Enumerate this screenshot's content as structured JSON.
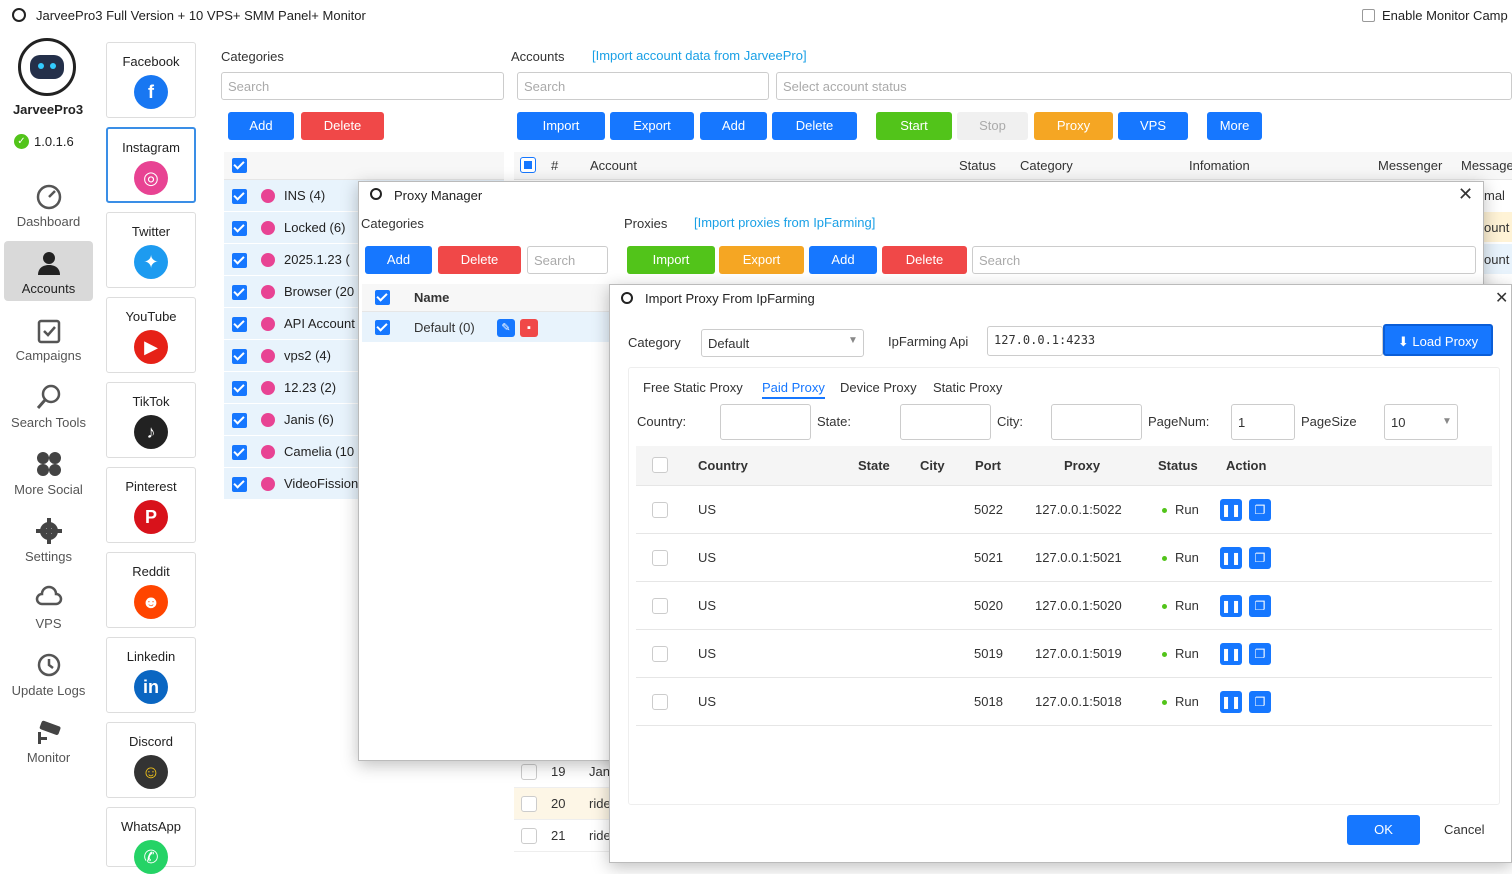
{
  "window": {
    "title": "JarveePro3 Full Version + 10 VPS+ SMM Panel+ Monitor",
    "enable_monitor": "Enable Monitor Camp"
  },
  "brand": {
    "name": "JarveePro3",
    "version": "1.0.1.6"
  },
  "nav": [
    "Dashboard",
    "Accounts",
    "Campaigns",
    "Search Tools",
    "More Social",
    "Settings",
    "VPS",
    "Update Logs",
    "Monitor"
  ],
  "social": [
    "Facebook",
    "Instagram",
    "Twitter",
    "YouTube",
    "TikTok",
    "Pinterest",
    "Reddit",
    "Linkedin",
    "Discord",
    "WhatsApp"
  ],
  "categories_panel": {
    "title": "Categories",
    "search": "Search",
    "add": "Add",
    "delete": "Delete",
    "rows": [
      "INS (4)",
      "Locked (6)",
      "2025.1.23 (",
      "Browser (20",
      "API Account",
      "vps2 (4)",
      "12.23 (2)",
      "Janis (6)",
      "Camelia (10",
      "VideoFission"
    ]
  },
  "accounts_panel": {
    "title": "Accounts",
    "import_link": "[Import account data from JarveePro]",
    "search": "Search",
    "status_placeholder": "Select account status",
    "buttons": {
      "import": "Import",
      "export": "Export",
      "add": "Add",
      "delete": "Delete",
      "start": "Start",
      "stop": "Stop",
      "proxy": "Proxy",
      "vps": "VPS",
      "more": "More"
    },
    "columns": {
      "num": "#",
      "account": "Account",
      "status": "Status",
      "category": "Category",
      "information": "Infomation",
      "messenger": "Messenger",
      "message": "Message"
    },
    "side_text": [
      "mal",
      "ount",
      "ount"
    ],
    "rows": [
      {
        "n": "19",
        "a": "Jan"
      },
      {
        "n": "20",
        "a": "ride"
      },
      {
        "n": "21",
        "a": "ride"
      }
    ]
  },
  "proxy_manager": {
    "title": "Proxy Manager",
    "categories": "Categories",
    "proxies": "Proxies",
    "import_link": "[Import proxies from IpFarming]",
    "add": "Add",
    "delete": "Delete",
    "search": "Search",
    "name_col": "Name",
    "default_row": "Default (0)",
    "import": "Import",
    "export": "Export",
    "add2": "Add",
    "delete2": "Delete",
    "search2": "Search"
  },
  "import_dialog": {
    "title": "Import Proxy From IpFarming",
    "category_label": "Category",
    "category_value": "Default",
    "api_label": "IpFarming Api",
    "api_value": "127.0.0.1:4233",
    "load_button": "Load Proxy",
    "tabs": [
      "Free Static Proxy",
      "Paid Proxy",
      "Device Proxy",
      "Static Proxy"
    ],
    "filters": {
      "country": "Country:",
      "state": "State:",
      "city": "City:",
      "pagenum": "PageNum:",
      "pagenum_value": "1",
      "pagesize": "PageSize",
      "pagesize_value": "10"
    },
    "columns": {
      "country": "Country",
      "state": "State",
      "city": "City",
      "port": "Port",
      "proxy": "Proxy",
      "status": "Status",
      "action": "Action"
    },
    "rows": [
      {
        "country": "US",
        "port": "5022",
        "proxy": "127.0.0.1:5022",
        "status": "Run"
      },
      {
        "country": "US",
        "port": "5021",
        "proxy": "127.0.0.1:5021",
        "status": "Run"
      },
      {
        "country": "US",
        "port": "5020",
        "proxy": "127.0.0.1:5020",
        "status": "Run"
      },
      {
        "country": "US",
        "port": "5019",
        "proxy": "127.0.0.1:5019",
        "status": "Run"
      },
      {
        "country": "US",
        "port": "5018",
        "proxy": "127.0.0.1:5018",
        "status": "Run"
      }
    ],
    "ok": "OK",
    "cancel": "Cancel"
  }
}
